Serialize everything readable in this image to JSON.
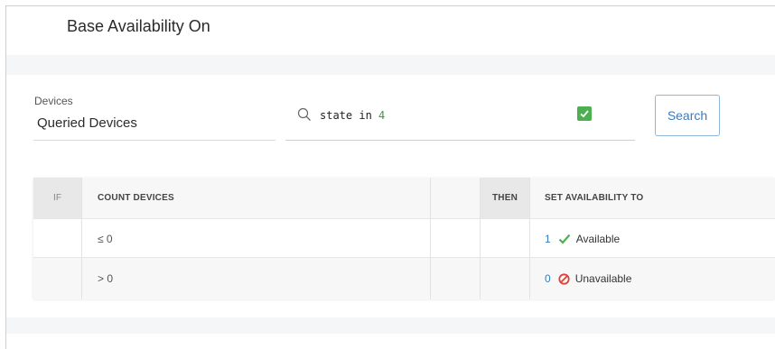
{
  "page": {
    "title": "Base Availability On"
  },
  "devices": {
    "label": "Devices",
    "value": "Queried Devices"
  },
  "search": {
    "query_keyword": "state in ",
    "query_value": "4",
    "button_label": "Search"
  },
  "table": {
    "headers": {
      "if": "IF",
      "count": "COUNT DEVICES",
      "then": "THEN",
      "set": "SET AVAILABILITY TO"
    },
    "rows": [
      {
        "condition": "≤ 0",
        "value": "1",
        "status": "Available",
        "status_icon": "check-icon"
      },
      {
        "condition": "> 0",
        "value": "0",
        "status": "Unavailable",
        "status_icon": "prohibited-icon"
      }
    ]
  },
  "colors": {
    "accent": "#3a7bbf",
    "success": "#4cb050",
    "danger": "#e0403a"
  }
}
